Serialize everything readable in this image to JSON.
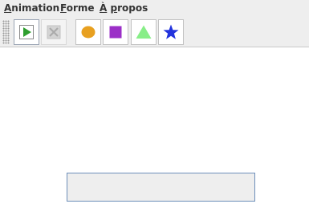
{
  "menubar": {
    "items": [
      {
        "label": "Animation",
        "mnemonic": "A",
        "rest": "nimation"
      },
      {
        "label": "Forme",
        "mnemonic": "F",
        "rest": "orme"
      },
      {
        "label": "À propos",
        "mnemonic": "À",
        "rest_pre": " ",
        "rest_mn": "p",
        "rest": "ropos"
      }
    ]
  },
  "toolbar": {
    "buttons": [
      {
        "name": "start-animation",
        "icon": "play-icon",
        "color": "#2e9e2e",
        "state": "selected"
      },
      {
        "name": "stop-animation",
        "icon": "stop-x-icon",
        "color": "#b9b9b9",
        "state": "disabled"
      },
      {
        "name": "shape-circle",
        "icon": "circle-icon",
        "color": "#e8a020",
        "state": "normal"
      },
      {
        "name": "shape-square",
        "icon": "square-icon",
        "color": "#9b2fc7",
        "state": "normal"
      },
      {
        "name": "shape-triangle",
        "icon": "triangle-icon",
        "color": "#88ee88",
        "state": "normal"
      },
      {
        "name": "shape-star",
        "icon": "star-icon",
        "color": "#2233dd",
        "state": "normal"
      }
    ]
  },
  "status": {
    "text": ""
  },
  "colors": {
    "window_bg": "#eeeeee",
    "canvas_bg": "#ffffff",
    "status_border": "#6d8fba"
  }
}
